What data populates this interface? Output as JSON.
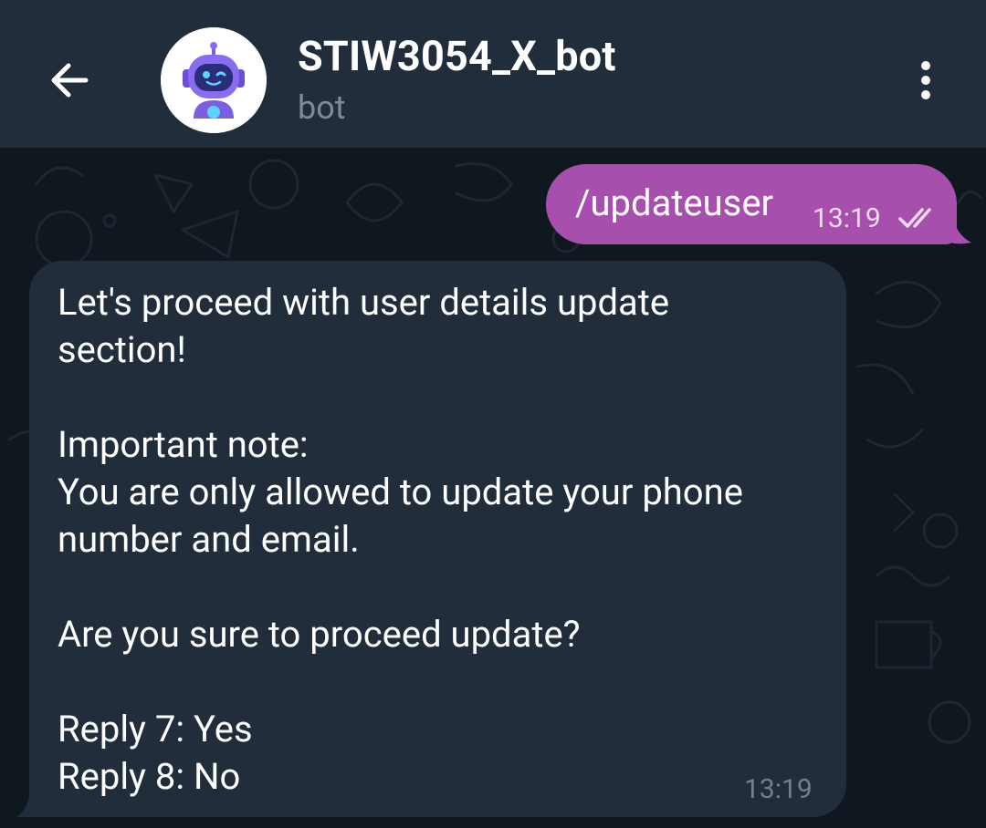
{
  "header": {
    "title": "STIW3054_X_bot",
    "subtitle": "bot"
  },
  "icons": {
    "back": "arrow-left-icon",
    "menu": "more-vertical-icon",
    "avatar": "robot-avatar",
    "read_status": "double-check-icon"
  },
  "messages": {
    "outgoing": {
      "text": "/updateuser",
      "time": "13:19"
    },
    "incoming": {
      "lines": [
        "Let's proceed with user details update",
        "section!",
        "",
        "Important note:",
        "You are only allowed to update your phone",
        "number and email.",
        "",
        "Are you sure to proceed update?",
        "",
        "Reply 7: Yes",
        "Reply 8: No"
      ],
      "time": "13:19"
    }
  },
  "colors": {
    "header_bg": "#212d3b",
    "chat_bg": "#0f171f",
    "outgoing_bubble": "#a74fac",
    "incoming_bubble": "#212d3b",
    "muted_text": "#7e8a98"
  }
}
